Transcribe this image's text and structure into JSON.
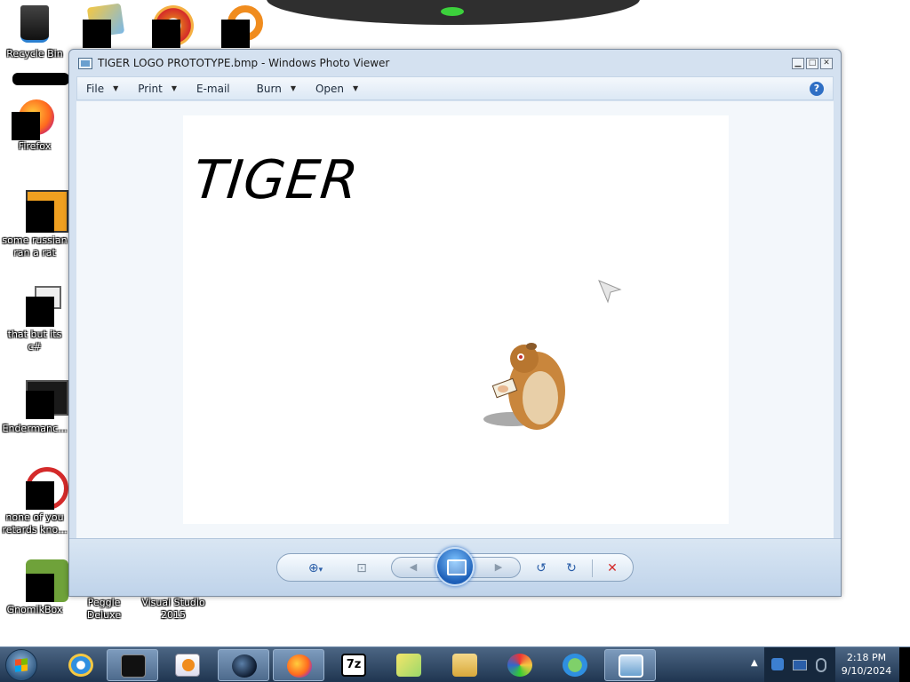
{
  "desktop": {
    "icons": [
      {
        "label": "Recycle Bin",
        "icon": "recycle-bin-icon"
      },
      {
        "label": "Firefox",
        "icon": "firefox-icon"
      },
      {
        "label": "some russian ran a rat",
        "icon": "app-e-icon"
      },
      {
        "label": "that but its c#",
        "icon": "windows-stack-icon"
      },
      {
        "label": "Endermanc...",
        "icon": "terminal-icon"
      },
      {
        "label": "none of you retards kno...",
        "icon": "red-circle-icon"
      },
      {
        "label": "GnomikBox",
        "icon": "gnome-box-icon"
      },
      {
        "label": "Peggle Deluxe",
        "icon": "peggle-icon"
      },
      {
        "label": "Visual Studio 2015",
        "icon": "visual-studio-icon"
      }
    ]
  },
  "window": {
    "title": "TIGER LOGO PROTOTYPE.bmp - Windows Photo Viewer",
    "controls": {
      "minimize": "▁",
      "maximize": "□",
      "close": "✕"
    },
    "menu": [
      {
        "label": "File",
        "has_dropdown": true
      },
      {
        "label": "Print",
        "has_dropdown": true
      },
      {
        "label": "E-mail",
        "has_dropdown": false
      },
      {
        "label": "Burn",
        "has_dropdown": true
      },
      {
        "label": "Open",
        "has_dropdown": true
      }
    ],
    "help": "?",
    "image": {
      "text": "TIGER"
    },
    "toolbar": {
      "zoom": "⊕",
      "zoom_arrow": "▾",
      "actual_size": "⊡",
      "previous": "◀",
      "next": "▶",
      "rotate_ccw": "↺",
      "rotate_cw": "↻",
      "delete": "✕",
      "colors": {
        "delete": "#d42a2a",
        "accent": "#2a5ea8"
      }
    }
  },
  "taskbar": {
    "pinned": [
      {
        "name": "internet-explorer-icon",
        "active": false
      },
      {
        "name": "terminal-app-icon",
        "active": true
      },
      {
        "name": "media-player-icon",
        "active": false
      },
      {
        "name": "globe-app-icon",
        "active": true
      },
      {
        "name": "firefox-taskbar-icon",
        "active": true
      },
      {
        "name": "7zip-icon",
        "active": false,
        "label": "7z"
      },
      {
        "name": "sticky-notes-icon",
        "active": false
      },
      {
        "name": "folder-icon",
        "active": false
      },
      {
        "name": "paint-icon",
        "active": false
      },
      {
        "name": "messenger-icon",
        "active": false
      },
      {
        "name": "photo-viewer-icon",
        "active": true
      }
    ],
    "clock": {
      "time": "2:18 PM",
      "date": "9/10/2024"
    },
    "tray_arrow": "▲"
  }
}
